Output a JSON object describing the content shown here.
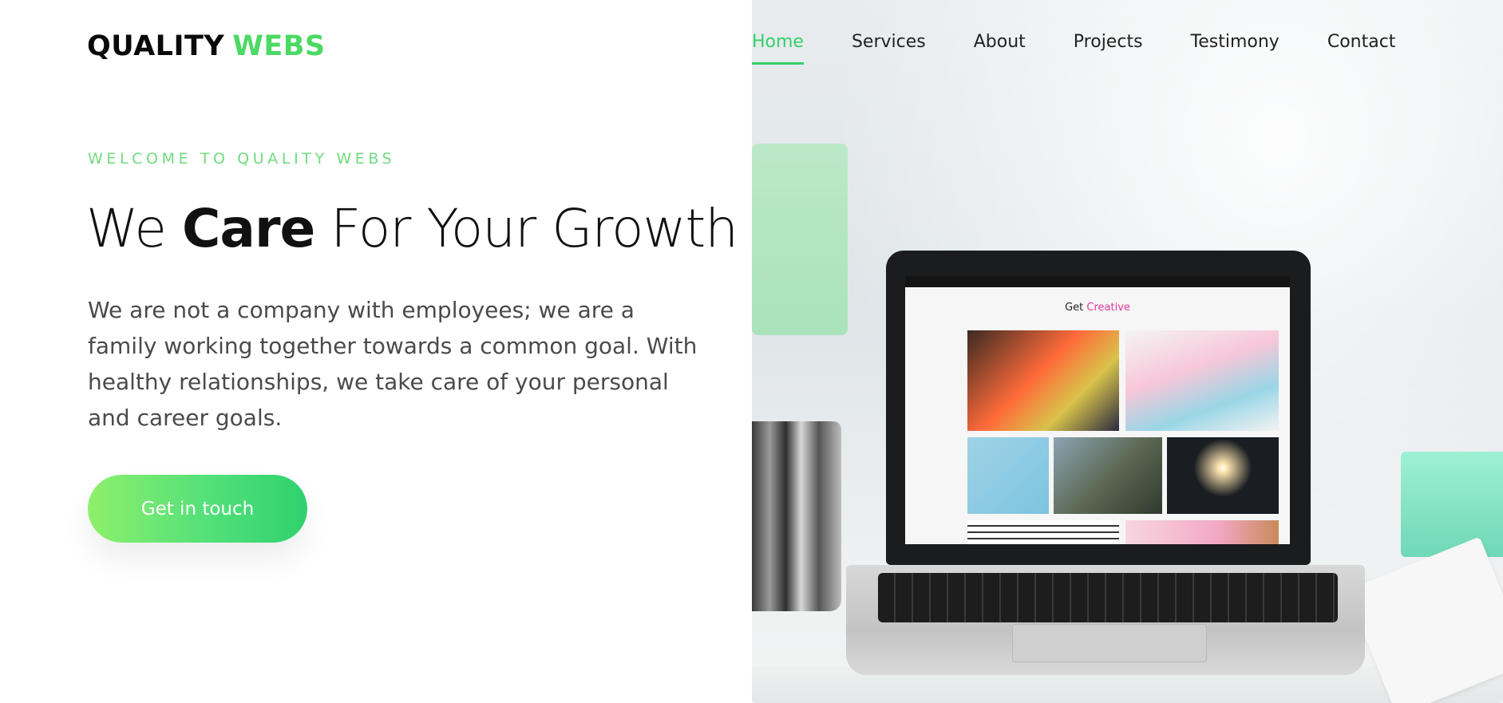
{
  "brand": {
    "part1": "QUALITY",
    "part2": "WEBS"
  },
  "nav": {
    "items": [
      {
        "label": "Home",
        "active": true
      },
      {
        "label": "Services",
        "active": false
      },
      {
        "label": "About",
        "active": false
      },
      {
        "label": "Projects",
        "active": false
      },
      {
        "label": "Testimony",
        "active": false
      },
      {
        "label": "Contact",
        "active": false
      }
    ]
  },
  "hero": {
    "eyebrow": "WELCOME TO QUALITY WEBS",
    "headline": {
      "before": "We ",
      "emphasis": "Care",
      "after": " For Your Growth"
    },
    "description": "We are not a company with employees; we are a family working together towards a common goal. With healthy relationships, we take care of your personal and career goals.",
    "cta_label": "Get in touch"
  },
  "screen": {
    "title_before": "Get ",
    "title_accent": "Creative"
  },
  "colors": {
    "accent": "#4cd964",
    "nav_active": "#35cf6a",
    "text_dark": "#111111",
    "text_body": "#4a4a4a",
    "cta_gradient_start": "#8ef06a",
    "cta_gradient_end": "#2fd26e"
  }
}
